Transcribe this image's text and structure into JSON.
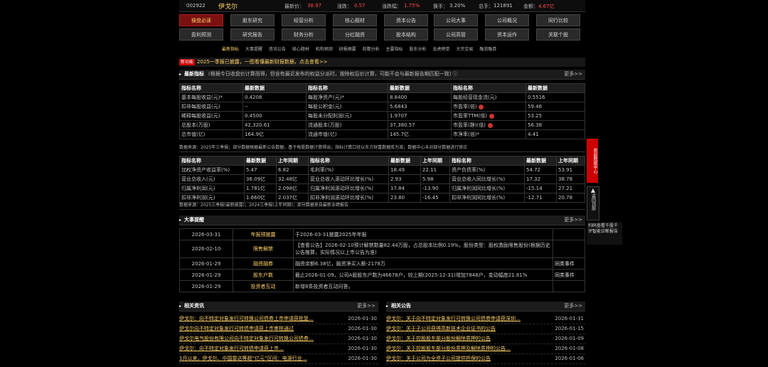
{
  "header": {
    "code": "002922",
    "name": "伊戈尔",
    "latest_label": "最新价：",
    "latest": "38.97",
    "change_label": "涨跌：",
    "change": "0.57",
    "pct_label": "涨跌幅：",
    "pct": "1.75%",
    "turnover_label": "换手：",
    "turnover": "3.20%",
    "volume_label": "总手：",
    "volume": "121891",
    "amount_label": "金额：",
    "amount": "4.67亿"
  },
  "nav1": [
    "操盘必读",
    "股东研究",
    "经营分析",
    "核心题材",
    "资本公告",
    "公司大事",
    "公司概况",
    "同行比较"
  ],
  "nav2": [
    "盈利预测",
    "研究报告",
    "财务分析",
    "分红融资",
    "股本结构",
    "公司高管",
    "资本运作",
    "关联个股"
  ],
  "subnav": [
    "最新指标",
    "大事提醒",
    "资讯公告",
    "核心题材",
    "机构预测",
    "研报摘要",
    "前瞻分析",
    "主要指标",
    "股东分析",
    "龙虎榜单",
    "大宗交易",
    "融资融券"
  ],
  "announce": {
    "tag": "新功能",
    "text": "2025一季报已披露，一图看懂最新财报数据，点击查看>>"
  },
  "indicators": {
    "title": "最新指标",
    "note": "(根据今日收盘价计算而得，但含有最近发布的权益分派时，按除权后价计算，可能不会与最新报告期匹配一致)",
    "more": "更多>>",
    "headers": [
      "指标名称",
      "最新数据",
      "指标名称",
      "最新数据",
      "指标名称",
      "最新数据"
    ],
    "rows": [
      [
        "基本每股收益(元)*",
        "0.4208",
        "每股净资产(元)*",
        "8.8400",
        "每股经营现金流(元)",
        "0.5516"
      ],
      [
        "扣非每股收益(元)",
        "--",
        "每股公积金(元)",
        "5.6843",
        "市盈率(倍)",
        "59.46"
      ],
      [
        "稀释每股收益(元)",
        "0.4500",
        "每股未分配利润(元)",
        "1.9707",
        "市盈率TTM(倍)",
        "53.25"
      ],
      [
        "总股本(万股)",
        "42,320.61",
        "流通股本(万股)",
        "37,380.57",
        "市盈率(静)(倍)",
        "56.38"
      ],
      [
        "总市值(亿)",
        "164.9亿",
        "流通市值(亿)",
        "145.7亿",
        "市净率(倍)*",
        "4.41"
      ]
    ],
    "foot": "数据来源：2025年三季报；部分数据根据最新公告数据，基于每股数据计算得出；指标计算口径以东方财富数据库为准；数据中心未对部分数据进行修正"
  },
  "growth": {
    "headers": [
      "指标名称",
      "最新数据",
      "上年同期",
      "指标名称",
      "最新数据",
      "上年同期",
      "指标名称",
      "最新数据",
      "上年同期"
    ],
    "rows": [
      [
        "加权净资产收益率(%)",
        "5.47",
        "6.82",
        "毛利率(%)",
        "18.49",
        "22.11",
        "资产负债率(%)",
        "54.72",
        "53.91"
      ],
      [
        "营业总收入(元)",
        "36.09亿",
        "32.48亿",
        "营业总收入滚动环比增长(%)",
        "2.93",
        "5.98",
        "营业总收入同比增长(%)",
        "17.32",
        "38.78"
      ],
      [
        "归属净利润(元)",
        "1.781亿",
        "2.098亿",
        "归属净利润滚动环比增长(%)",
        "17.84",
        "-13.90",
        "归属净利润同比增长(%)",
        "-15.14",
        "27.21"
      ],
      [
        "扣非净利润(元)",
        "1.660亿",
        "2.037亿",
        "扣非净利润滚动环比增长(%)",
        "23.80",
        "-16.45",
        "扣非净利润同比增长(%)",
        "-12.71",
        "20.78"
      ]
    ],
    "foot": "数据来源：2025三季报(最新披露)；2024三季报(上年同期)；部分数据来自最新业绩报告"
  },
  "events": {
    "title": "大事提醒",
    "more": "更多>>",
    "rows": [
      {
        "date": "2026-03-31",
        "type": "年报预披露",
        "text": "于2026-03-31披露2025年年报",
        "rel": ""
      },
      {
        "date": "2026-02-10",
        "type": "限售解禁",
        "text": "【查看公告】2026-02-10预计解禁数量82.44万股，占总股本比例0.19%，股份类型：股权激励限售股份(根据历史公告推算，实际情况以上市公告为准)",
        "rel": ""
      },
      {
        "date": "2026-01-29",
        "type": "融资融券",
        "text": "融资余额6.38亿，融资净买入额-2178万",
        "rel": "同类事件"
      },
      {
        "date": "2026-01-29",
        "type": "股东户数",
        "text": "截止2026-01-09，公司A股股东户数为46678户，较上期(2025-12-31)增加7848户，变动幅度21.81%",
        "rel": "同类事件"
      },
      {
        "date": "2026-01-29",
        "type": "投资者互动",
        "text": "新增8条投资者互动问答。",
        "rel": ""
      }
    ]
  },
  "news": {
    "title": "相关资讯",
    "more": "更多>>",
    "rows": [
      {
        "t": "伊戈尔：向不特定对象发行可转换公司债券上市申请获批复…",
        "d": "2026-01-30"
      },
      {
        "t": "伊戈尔向不特定对象发行可转债申请获上市审核通过",
        "d": "2026-01-30"
      },
      {
        "t": "伊戈尔电气股份有限公司向不特定对象发行可转换公司债券…",
        "d": "2026-01-30"
      },
      {
        "t": "伊戈尔：向不特定对象发行可转债申请获上市…",
        "d": "2026-01-30"
      },
      {
        "t": "1月以来，伊戈尔、中国雷达等超“亿元”区间：电源行业…",
        "d": "2026-01-30"
      }
    ]
  },
  "notices": {
    "title": "相关公告",
    "more": "更多>>",
    "rows": [
      {
        "t": "伊戈尔：关于向不特定对象发行可转换公司债券申请获深圳…",
        "d": "2026-01-31"
      },
      {
        "t": "伊戈尔：关于子公司获得高新技术企业证书的公告",
        "d": "2026-01-15"
      },
      {
        "t": "伊戈尔：关于控股股东部分股份解除质押的公告",
        "d": "2026-01-09"
      },
      {
        "t": "伊戈尔：关于控股股东部分股份质押及解除质押的公告…",
        "d": "2026-01-08"
      },
      {
        "t": "伊戈尔：关于公司为全资子公司提供担保的公告",
        "d": "2026-01-06"
      }
    ]
  },
  "side": {
    "vertical": "收起数据中心",
    "back": "返回顶部",
    "card": "扫码查看千股千评智能诊断报告"
  },
  "colors": {
    "accent": "#ffd36a",
    "up": "#ff4d4d",
    "active_tab": "#7a1010"
  }
}
